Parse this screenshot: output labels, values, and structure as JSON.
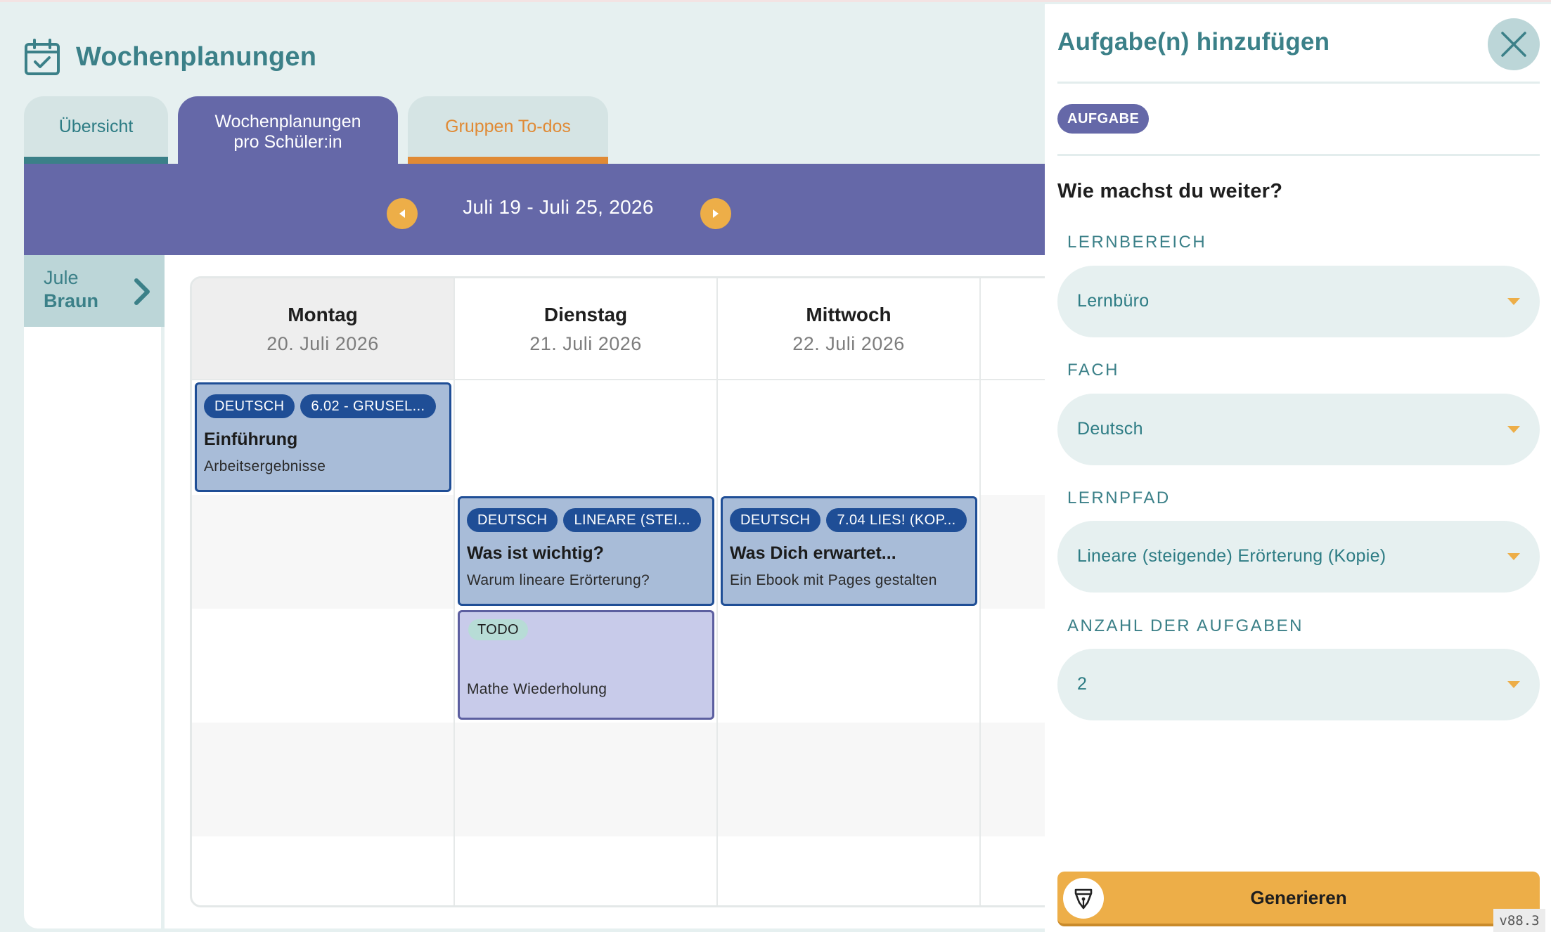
{
  "header": {
    "title": "Wochenplanungen",
    "icon": "calendar-check-icon"
  },
  "tabs": [
    {
      "label": "Übersicht"
    },
    {
      "label": "Wochenplanungen\npro Schüler:in"
    },
    {
      "label": "Gruppen To-dos"
    }
  ],
  "week": {
    "label": "Juli 19 - Juli 25, 2026"
  },
  "student": {
    "first_name": "Jule",
    "last_name": "Braun"
  },
  "days": [
    {
      "name": "Montag",
      "date": "20. Juli 2026"
    },
    {
      "name": "Dienstag",
      "date": "21. Juli 2026"
    },
    {
      "name": "Mittwoch",
      "date": "22. Juli 2026"
    }
  ],
  "cards": [
    {
      "badges": [
        "DEUTSCH",
        "6.02 - GRUSEL..."
      ],
      "title": "Einführung",
      "subtitle": "Arbeitsergebnisse"
    },
    {
      "badges": [
        "DEUTSCH",
        "LINEARE (STEI..."
      ],
      "title": "Was ist wichtig?",
      "subtitle": "Warum lineare Erörterung?"
    },
    {
      "badges": [
        "DEUTSCH",
        "7.04 LIES! (KOP..."
      ],
      "title": "Was Dich erwartet...",
      "subtitle": "Ein Ebook mit Pages gestalten"
    },
    {
      "badges": [
        "TODO"
      ],
      "title": "",
      "subtitle": "Mathe Wiederholung"
    }
  ],
  "panel": {
    "title": "Aufgabe(n) hinzufügen",
    "type_badge": "AUFGABE",
    "question": "Wie machst du weiter?",
    "fields": [
      {
        "label": "LERNBEREICH",
        "value": "Lernbüro"
      },
      {
        "label": "FACH",
        "value": "Deutsch"
      },
      {
        "label": "LERNPFAD",
        "value": "Lineare (steigende) Erörterung (Kopie)"
      },
      {
        "label": "ANZAHL DER AUFGABEN",
        "value": "2"
      }
    ],
    "generate_label": "Generieren"
  },
  "version": "v88.3",
  "colors": {
    "teal": "#3b8088",
    "purple": "#6568a8",
    "orange": "#edae48",
    "navy": "#1f4e96",
    "card_blue": "#a8bcd8",
    "todo_purple": "#c8cbea",
    "background": "#e6f0f0"
  }
}
